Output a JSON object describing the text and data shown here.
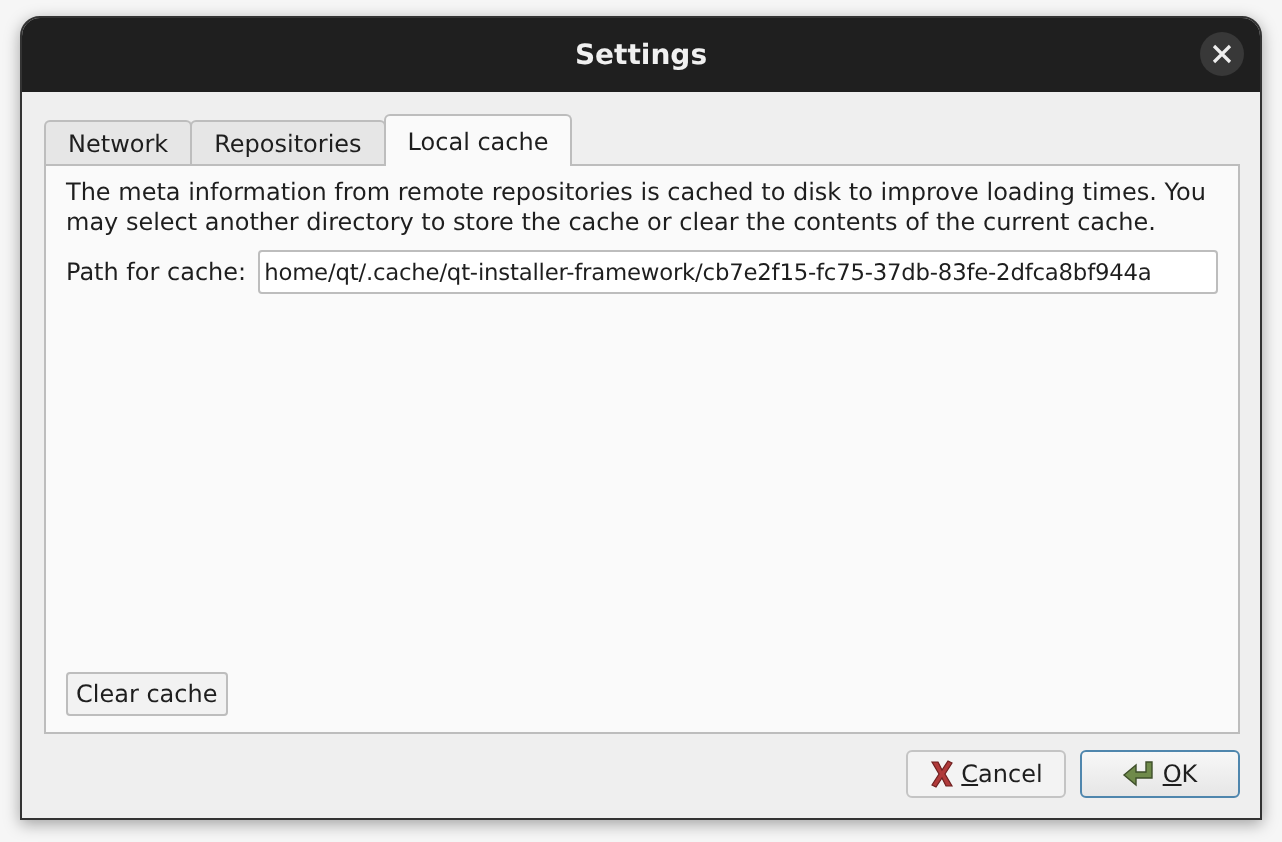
{
  "window": {
    "title": "Settings"
  },
  "tabs": [
    {
      "label": "Network",
      "selected": false
    },
    {
      "label": "Repositories",
      "selected": false
    },
    {
      "label": "Local cache",
      "selected": true
    }
  ],
  "local_cache": {
    "description": "The meta information from remote repositories is cached to disk to improve loading times. You may select another directory to store the cache or clear the contents of the current cache.",
    "path_label": "Path for cache:",
    "path_value": "home/qt/.cache/qt-installer-framework/cb7e2f15-fc75-37db-83fe-2dfca8bf944a",
    "clear_button": "Clear cache"
  },
  "buttons": [
    {
      "kind": "cancel",
      "label": "Cancel"
    },
    {
      "kind": "ok",
      "label": "OK"
    }
  ]
}
